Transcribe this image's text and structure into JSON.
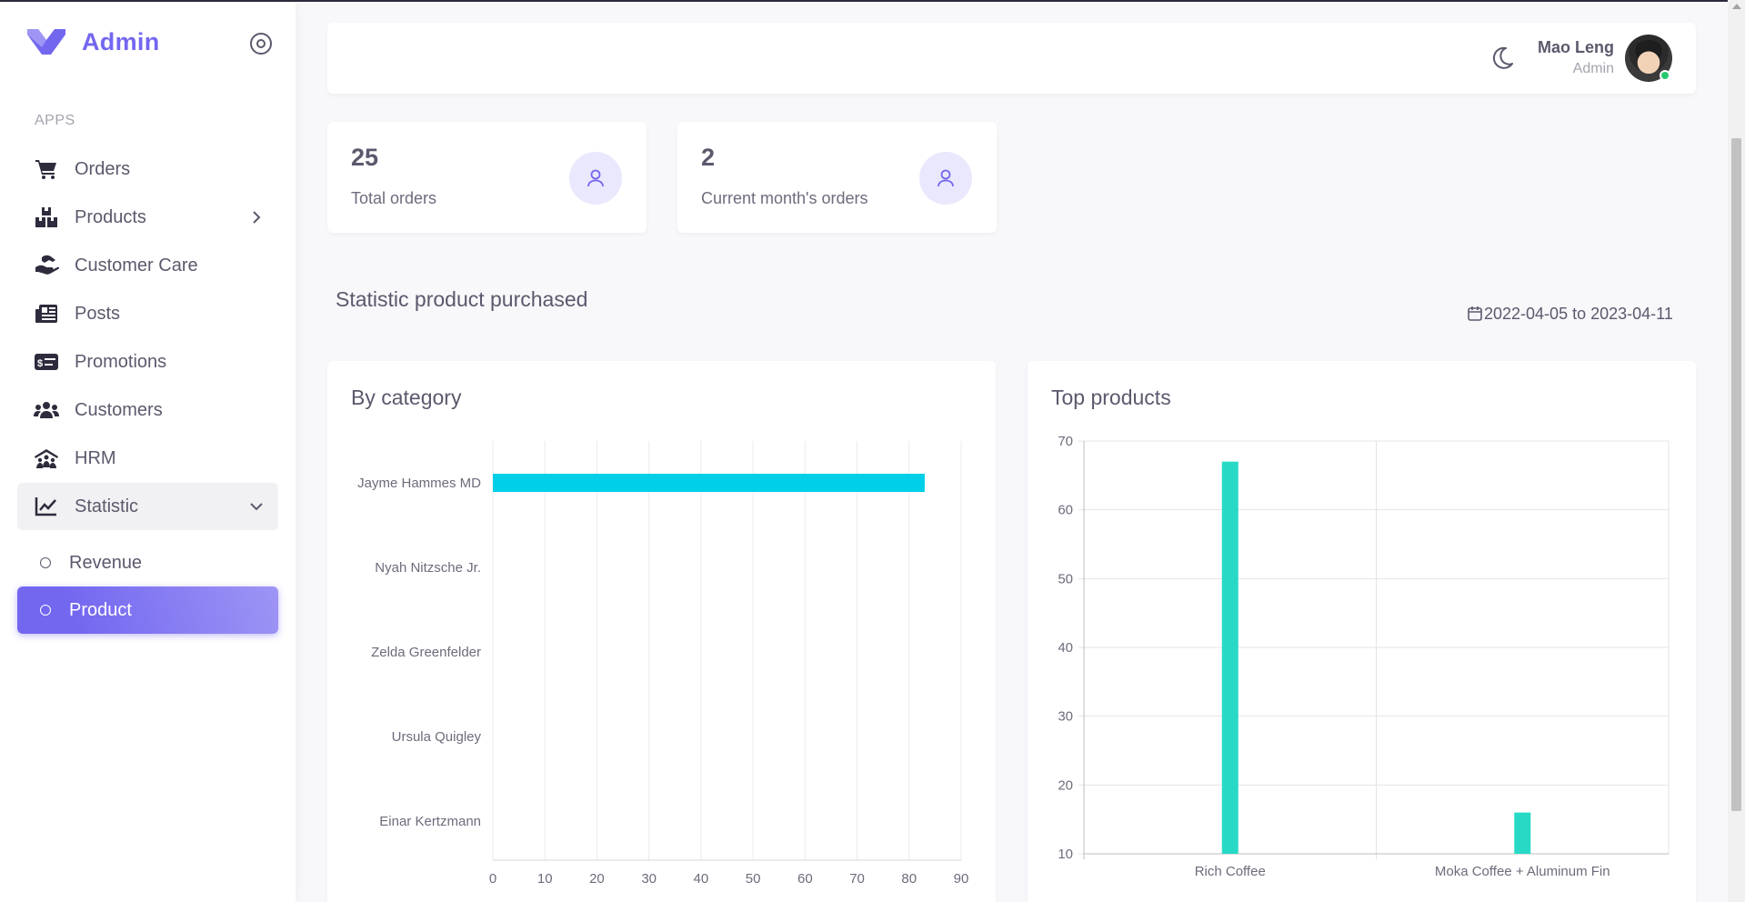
{
  "app": {
    "title": "Admin"
  },
  "sidebar": {
    "section_title": "APPS",
    "items": [
      {
        "label": "Orders",
        "icon": "cart-icon"
      },
      {
        "label": "Products",
        "icon": "boxes-icon",
        "has_children": true
      },
      {
        "label": "Customer Care",
        "icon": "hand-care-icon"
      },
      {
        "label": "Posts",
        "icon": "newspaper-icon"
      },
      {
        "label": "Promotions",
        "icon": "money-bill-icon"
      },
      {
        "label": "Customers",
        "icon": "users-icon"
      },
      {
        "label": "HRM",
        "icon": "people-roof-icon"
      },
      {
        "label": "Statistic",
        "icon": "chart-line-icon",
        "expanded": true
      }
    ],
    "subitems": [
      {
        "label": "Revenue",
        "active": false
      },
      {
        "label": "Product",
        "active": true
      }
    ]
  },
  "header": {
    "user_name": "Mao Leng",
    "user_role": "Admin",
    "theme_icon": "moon-icon",
    "status_color": "#28c76f"
  },
  "stats": [
    {
      "value": "25",
      "label": "Total orders",
      "icon": "user-icon"
    },
    {
      "value": "2",
      "label": "Current month's orders",
      "icon": "user-icon"
    }
  ],
  "statistic": {
    "heading": "Statistic product purchased",
    "date_range": "2022-04-05 to 2023-04-11"
  },
  "colors": {
    "accent": "#7367f0",
    "cyan_bar": "#00cfe8",
    "teal_bar": "#28dac6"
  },
  "chart_data": [
    {
      "type": "bar",
      "orientation": "horizontal",
      "title": "By category",
      "categories": [
        "Jayme Hammes MD",
        "Nyah Nitzsche Jr.",
        "Zelda Greenfelder",
        "Ursula Quigley",
        "Einar Kertzmann"
      ],
      "values": [
        83,
        0,
        0,
        0,
        0
      ],
      "xlim": [
        0,
        90
      ],
      "xticks": [
        0,
        10,
        20,
        30,
        40,
        50,
        60,
        70,
        80,
        90
      ],
      "color": "#00cfe8",
      "grid": true
    },
    {
      "type": "bar",
      "title": "Top products",
      "categories": [
        "Rich Coffee",
        "Moka Coffee + Aluminum Fin"
      ],
      "values": [
        67,
        16
      ],
      "ylim": [
        10,
        70
      ],
      "yticks": [
        10,
        20,
        30,
        40,
        50,
        60,
        70
      ],
      "color": "#28dac6",
      "grid": true
    }
  ]
}
